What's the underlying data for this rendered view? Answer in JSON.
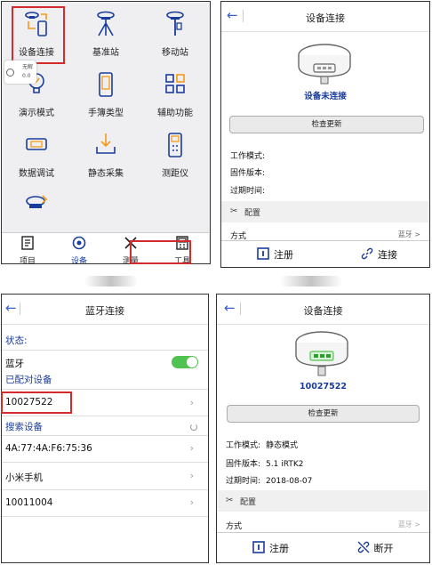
{
  "panel1": {
    "grid": [
      {
        "label": "设备连接",
        "icon": "device-connect-icon"
      },
      {
        "label": "基准站",
        "icon": "base-station-icon"
      },
      {
        "label": "移动站",
        "icon": "rover-icon"
      },
      {
        "label": "演示模式",
        "icon": "demo-mode-icon"
      },
      {
        "label": "手簿类型",
        "icon": "handbook-type-icon"
      },
      {
        "label": "辅助功能",
        "icon": "auxiliary-icon"
      },
      {
        "label": "数据调试",
        "icon": "data-debug-icon"
      },
      {
        "label": "静态采集",
        "icon": "static-collect-icon"
      },
      {
        "label": "测距仪",
        "icon": "rangefinder-icon"
      },
      {
        "label": "",
        "icon": "device-settings-icon"
      }
    ],
    "float_widget": {
      "line1": "无解",
      "line2": "0.0"
    },
    "tabs": [
      {
        "label": "项目",
        "icon": "project-icon"
      },
      {
        "label": "设备",
        "icon": "device-icon"
      },
      {
        "label": "测量",
        "icon": "survey-icon"
      },
      {
        "label": "工具",
        "icon": "tools-icon"
      }
    ],
    "active_tab": "设备"
  },
  "panel2": {
    "title": "设备连接",
    "back": "←",
    "device_status": "设备未连接",
    "check_update": "检查更新",
    "info": {
      "mode_label": "工作模式:",
      "firmware_label": "固件版本:",
      "expire_label": "过期时间:"
    },
    "config_label": "配置",
    "method_label": "方式",
    "method_value": "蓝牙 >",
    "register": "注册",
    "connect": "连接"
  },
  "panel3": {
    "title": "蓝牙连接",
    "back": "←",
    "status_label": "状态:",
    "bluetooth_label": "蓝牙",
    "paired_label": "已配对设备",
    "paired": [
      "10027522"
    ],
    "search_label": "搜索设备",
    "found": [
      "4A:77:4A:F6:75:36",
      "小米手机",
      "10011004"
    ]
  },
  "panel4": {
    "title": "设备连接",
    "back": "←",
    "device_id": "10027522",
    "check_update": "检查更新",
    "info": {
      "mode_label": "工作模式:",
      "mode_value": "静态模式",
      "firmware_label": "固件版本:",
      "firmware_value": "5.1  iRTK2",
      "expire_label": "过期时间:",
      "expire_value": "2018-08-07"
    },
    "config_label": "配置",
    "method_label": "方式",
    "method_value": "蓝牙 >",
    "register": "注册",
    "disconnect": "断开"
  },
  "colors": {
    "accent": "#1a3d9c",
    "highlight": "#d42a2a",
    "toggle_on": "#4fc24f"
  }
}
